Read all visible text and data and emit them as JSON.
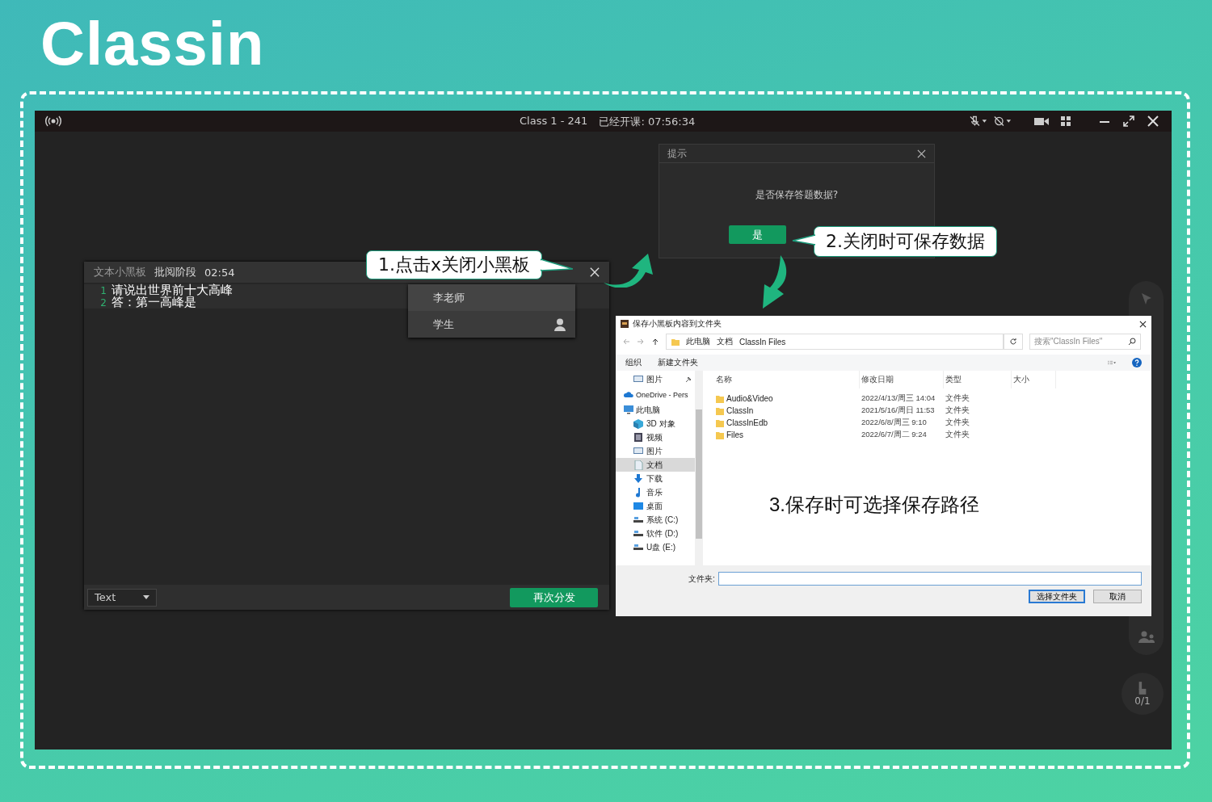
{
  "logo": "Classin",
  "title_bar": {
    "title": "Class 1 - 241",
    "timer": "已经开课: 07:56:34"
  },
  "whiteboard": {
    "title": "文本小黑板",
    "stage": "批阅阶段",
    "time": "02:54",
    "lines": [
      {
        "number": "1",
        "text": "请说出世界前十大高峰"
      },
      {
        "number": "2",
        "text": "答：第一高峰是"
      }
    ],
    "students": [
      {
        "name": "李老师",
        "kind": "teacher"
      },
      {
        "name": "学生",
        "kind": "student"
      }
    ],
    "format_dropdown": "Text",
    "redistribute_button": "再次分发"
  },
  "tip_dialog": {
    "title": "提示",
    "message": "是否保存答题数据?",
    "confirm_button": "是"
  },
  "callouts": [
    {
      "text": "1.点击x关闭小黑板"
    },
    {
      "text": "2.关闭时可保存数据"
    }
  ],
  "file_dialog": {
    "title": "保存小黑板内容到文件夹",
    "path": [
      "此电脑",
      "文档",
      "ClassIn Files"
    ],
    "search_placeholder": "搜索\"ClassIn Files\"",
    "toolbar": [
      "组织",
      "新建文件夹"
    ],
    "sidebar": [
      {
        "label": "图片",
        "kind": "pinned",
        "selected": false
      },
      {
        "label": "OneDrive - Pers",
        "kind": "cloud",
        "selected": false
      },
      {
        "label": "此电脑",
        "kind": "pc",
        "selected": false
      },
      {
        "label": "3D 对象",
        "kind": "cube",
        "selected": false
      },
      {
        "label": "视频",
        "kind": "video",
        "selected": false
      },
      {
        "label": "图片",
        "kind": "image",
        "selected": false
      },
      {
        "label": "文档",
        "kind": "doc",
        "selected": true
      },
      {
        "label": "下载",
        "kind": "download",
        "selected": false
      },
      {
        "label": "音乐",
        "kind": "music",
        "selected": false
      },
      {
        "label": "桌面",
        "kind": "desktop",
        "selected": false
      },
      {
        "label": "系统 (C:)",
        "kind": "drive",
        "selected": false
      },
      {
        "label": "软件 (D:)",
        "kind": "drive",
        "selected": false
      },
      {
        "label": "U盘 (E:)",
        "kind": "drive",
        "selected": false
      }
    ],
    "columns": [
      "名称",
      "修改日期",
      "类型",
      "大小"
    ],
    "rows": [
      [
        "Audio&Video",
        "2022/4/13/周三 14:04",
        "文件夹"
      ],
      [
        "ClassIn",
        "2021/5/16/周日 11:53",
        "文件夹"
      ],
      [
        "ClassInEdb",
        "2022/6/8/周三 9:10",
        "文件夹"
      ],
      [
        "Files",
        "2022/6/7/周二 9:24",
        "文件夹"
      ]
    ],
    "annotation": "3.保存时可选择保存路径",
    "folder_label": "文件夹:",
    "select_button": "选择文件夹",
    "cancel_button": "取消"
  },
  "hand_raise": {
    "count": "0/1"
  }
}
